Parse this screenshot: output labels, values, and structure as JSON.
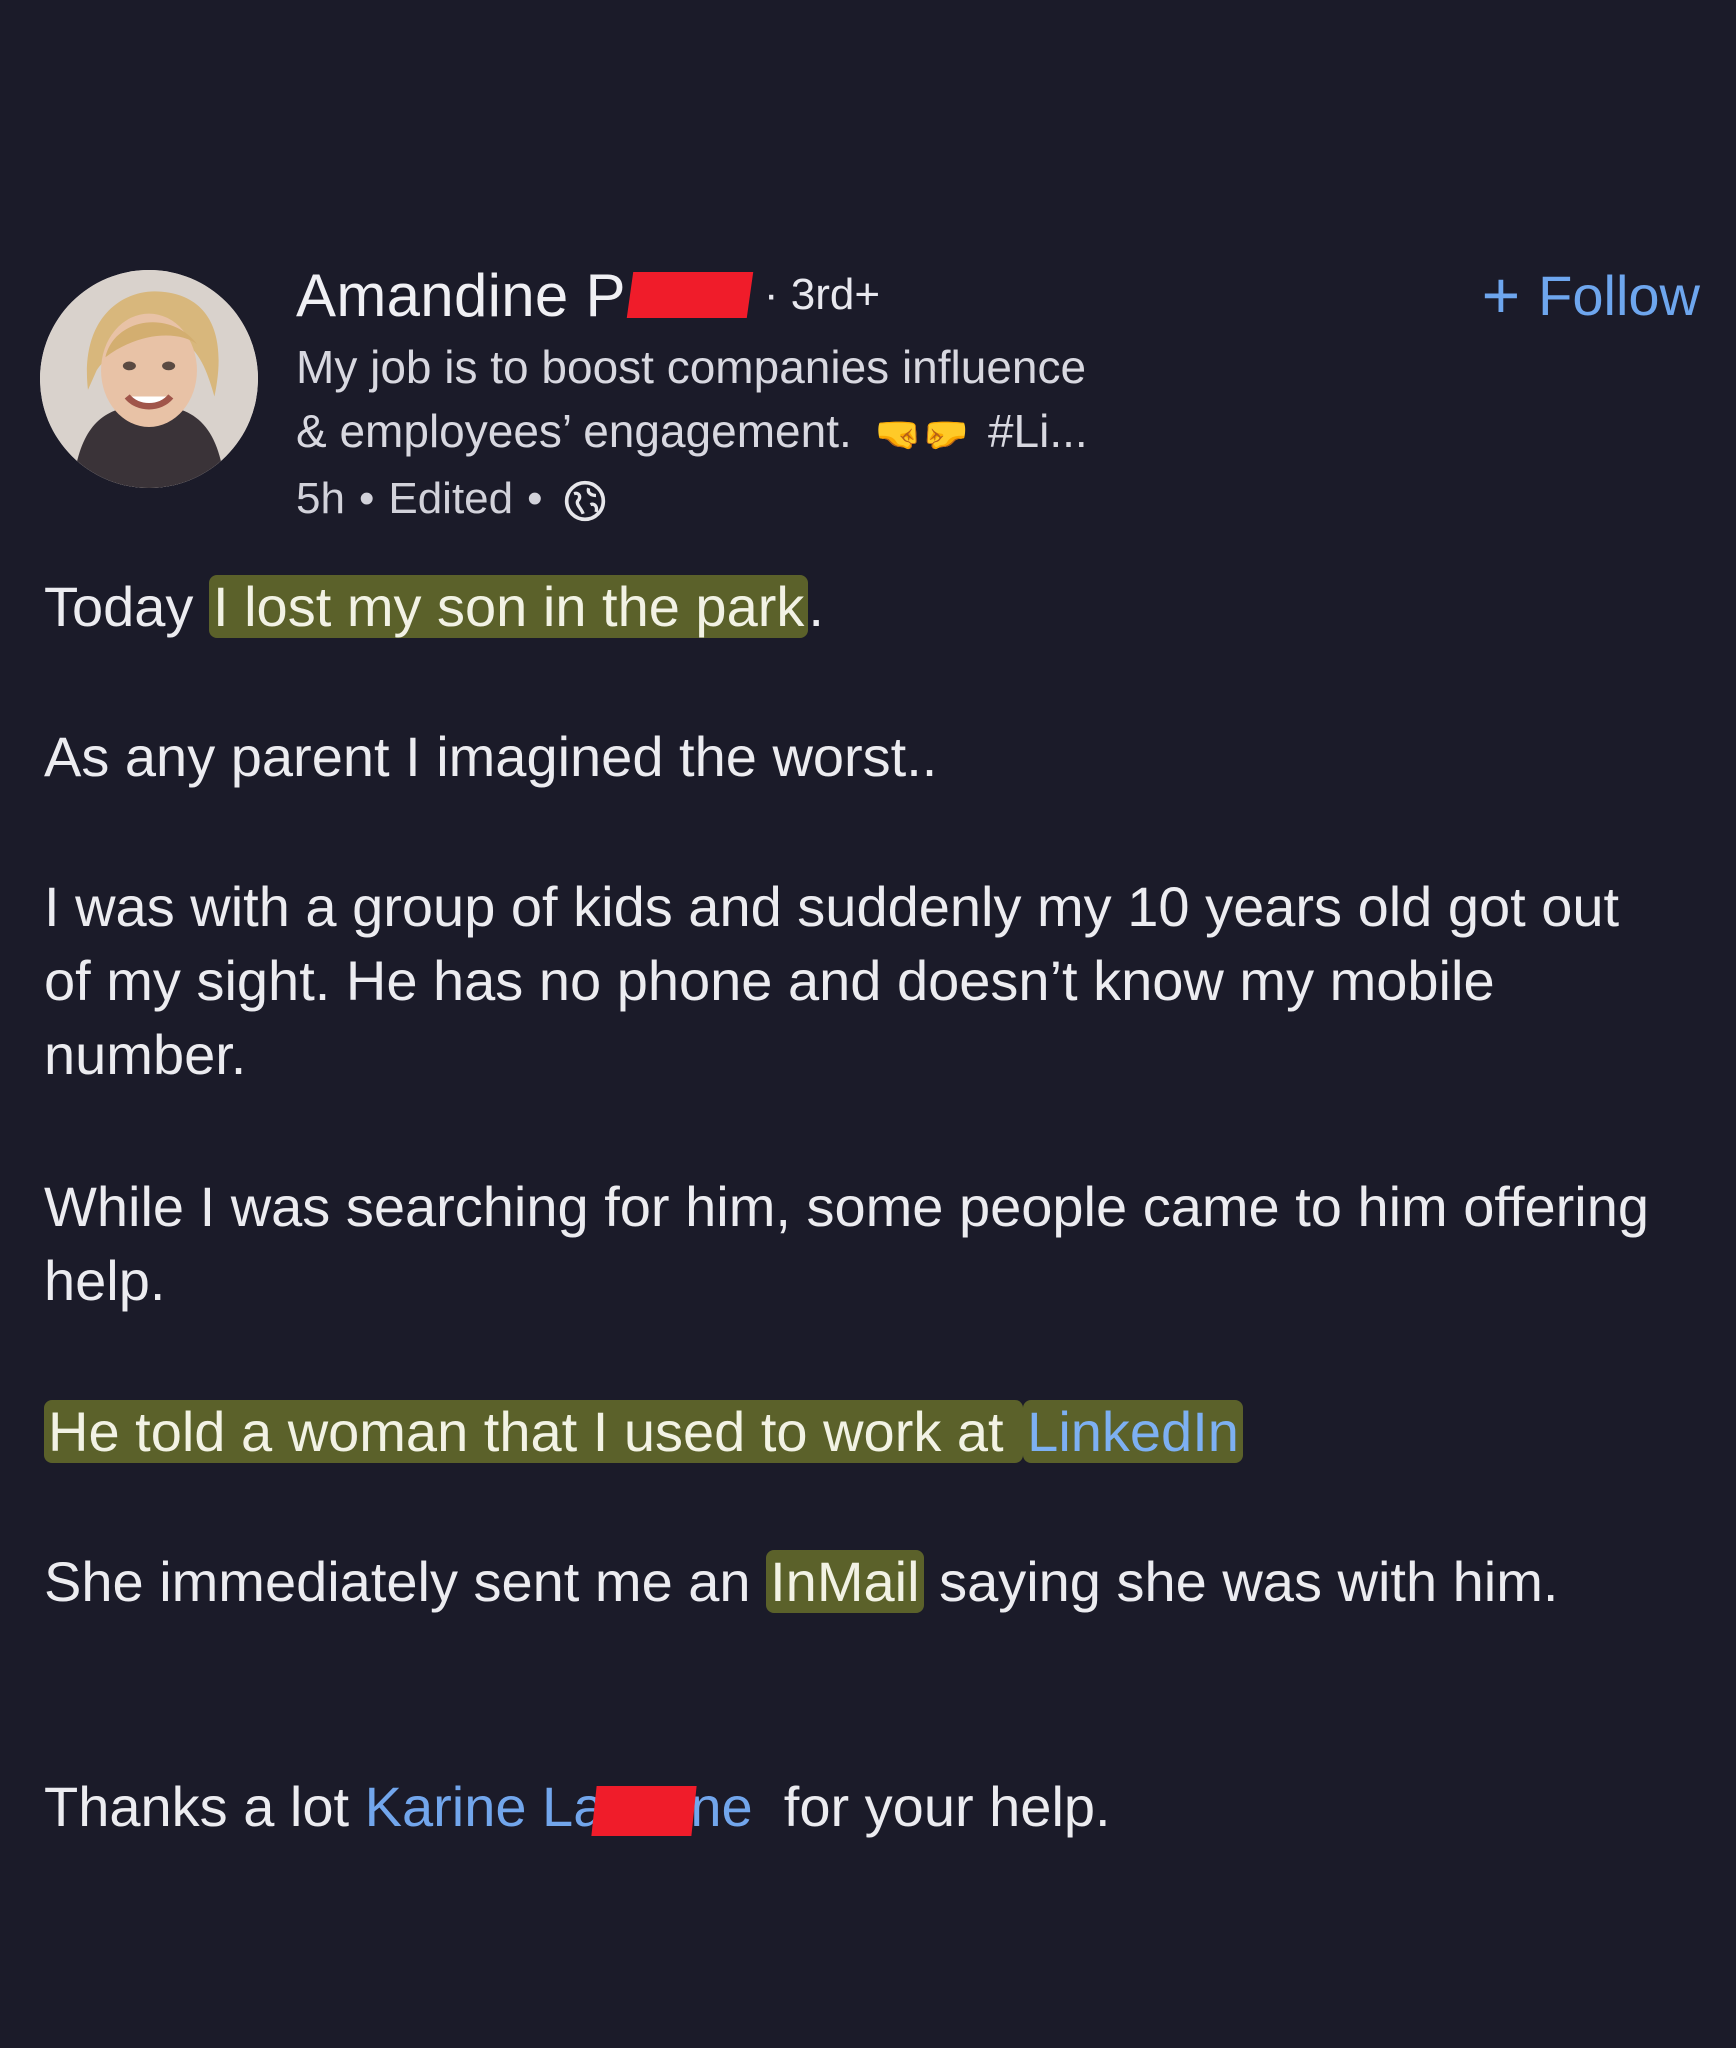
{
  "author": {
    "name_visible": "Amandine P",
    "degree": "· 3rd+",
    "headline_line1": "My job is to boost companies influence",
    "headline_line2": "& employees’ engagement.",
    "headline_icon": "handshake-icon",
    "headline_tag": "#Li...",
    "time": "5h",
    "edited": "Edited",
    "visibility_icon": "globe-icon"
  },
  "follow": {
    "label": "Follow",
    "icon": "plus-icon"
  },
  "post": {
    "p1_before": "Today ",
    "p1_highlight": "I lost my son in the park",
    "p1_after": ".",
    "p2": "As any parent I imagined the worst..",
    "p3": "I was with a group of kids and suddenly my 10 years old got out of my sight. He has no phone and doesn’t know my mobile number.",
    "p4": "While I was searching for him, some people came to him offering help.",
    "p5_highlight": "He told a woman that I used to work at ",
    "p5_link": "LinkedIn",
    "p6_before": "She immediately sent me an ",
    "p6_highlight": "InMail",
    "p6_after": " saying she was with him.",
    "p7_before": "Thanks a lot ",
    "p7_mention_start": "Karine La",
    "p7_mention_end": "ne",
    "p7_after": "  for your help."
  },
  "colors": {
    "background": "#1b1b29",
    "highlight": "#5b612a",
    "link": "#72a6ec",
    "redaction": "#f01c2a"
  }
}
